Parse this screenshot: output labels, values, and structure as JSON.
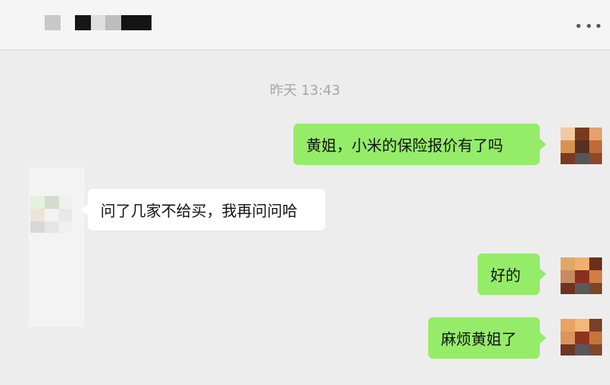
{
  "header": {
    "title_redacted": true,
    "more_icon": "more-icon"
  },
  "timestamp": "昨天 13:43",
  "messages": [
    {
      "direction": "sent",
      "text": "黄姐，小米的保险报价有了吗"
    },
    {
      "direction": "received",
      "text": "问了几家不给买，我再问问哈"
    },
    {
      "direction": "sent",
      "text": "好的"
    },
    {
      "direction": "sent",
      "text": "麻烦黄姐了"
    }
  ],
  "colors": {
    "background": "#ededed",
    "sent_bubble": "#95ec69",
    "received_bubble": "#ffffff",
    "timestamp": "#a5a5a5"
  }
}
